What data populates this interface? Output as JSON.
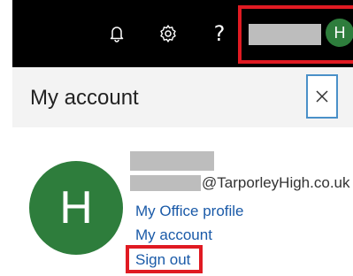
{
  "topbar": {
    "icons": [
      "bell-icon",
      "gear-icon",
      "help-icon"
    ],
    "help_glyph": "?",
    "avatar_initial": "H"
  },
  "panel": {
    "title": "My account",
    "close_glyph": "×"
  },
  "profile": {
    "avatar_initial": "H",
    "email_domain": "@TarporleyHigh.co.uk",
    "links": {
      "office_profile": "My Office profile",
      "my_account": "My account",
      "sign_out": "Sign out"
    }
  },
  "colors": {
    "topbar_bg": "#000000",
    "avatar_green": "#2e7d3c",
    "highlight_red": "#e01a22",
    "link_blue": "#1a5aa8",
    "header_bg": "#f3f3f3"
  }
}
